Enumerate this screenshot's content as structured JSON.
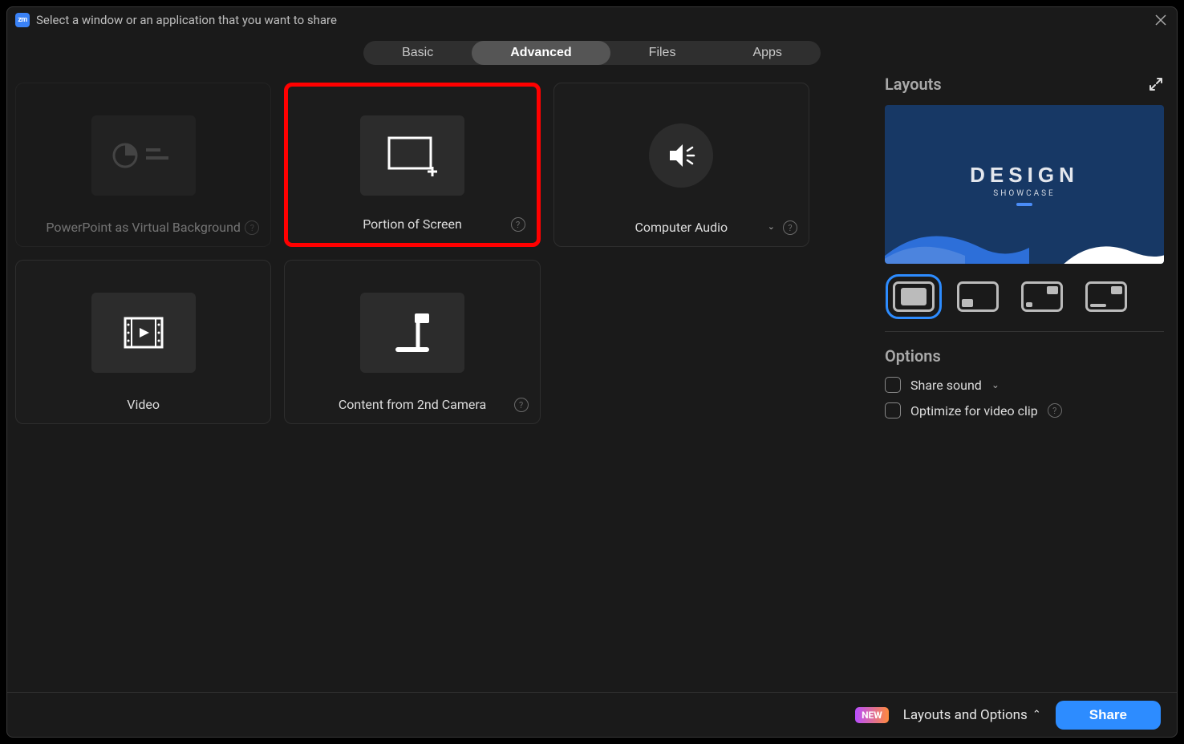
{
  "titlebar": {
    "logo_text": "zm",
    "title": "Select a window or an application that you want to share"
  },
  "tabs": {
    "basic": "Basic",
    "advanced": "Advanced",
    "files": "Files",
    "apps": "Apps"
  },
  "cards": {
    "ppt": "PowerPoint as Virtual Background",
    "portion": "Portion of Screen",
    "audio": "Computer Audio",
    "video": "Video",
    "second_cam": "Content from 2nd Camera"
  },
  "right": {
    "layouts_header": "Layouts",
    "preview_title": "DESIGN",
    "preview_sub": "SHOWCASE",
    "options_header": "Options",
    "share_sound": "Share sound",
    "optimize": "Optimize for video clip"
  },
  "footer": {
    "new_badge": "NEW",
    "layouts_options": "Layouts and Options",
    "share": "Share"
  },
  "help_glyph": "?"
}
